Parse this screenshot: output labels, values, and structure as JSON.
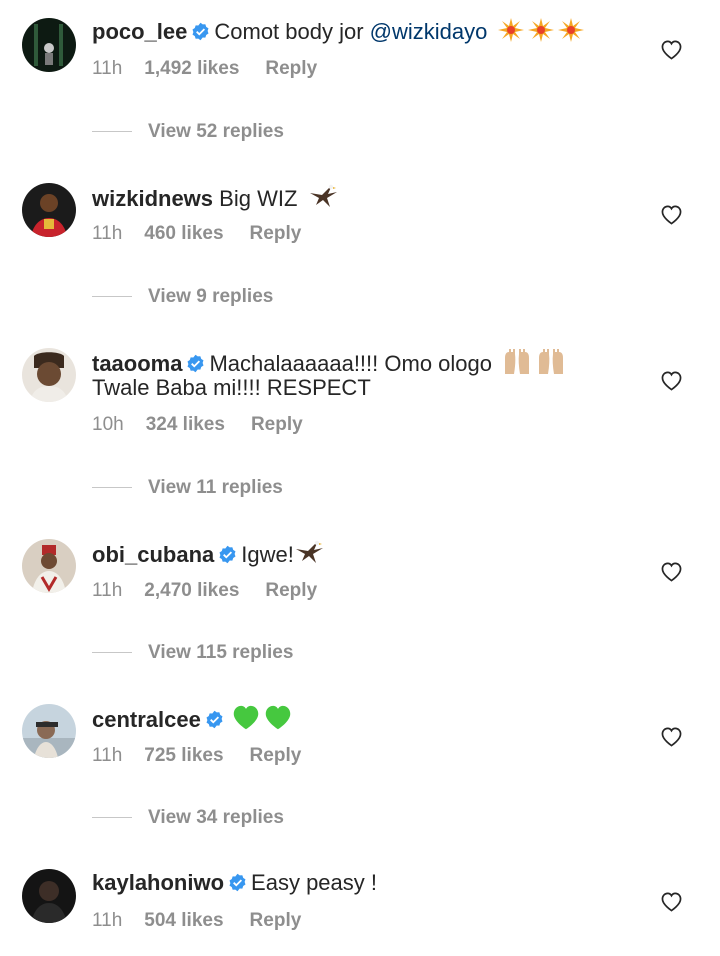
{
  "comments": [
    {
      "username": "poco_lee",
      "verified": true,
      "text": "Comot body jor ",
      "mention": "@wizkidayo",
      "time": "11h",
      "likes": "1,492 likes",
      "reply_label": "Reply",
      "view_replies": "View 52 replies"
    },
    {
      "username": "wizkidnews",
      "verified": false,
      "text": "Big WIZ",
      "time": "11h",
      "likes": "460 likes",
      "reply_label": "Reply",
      "view_replies": "View 9 replies"
    },
    {
      "username": "taaooma",
      "verified": true,
      "text": "Machalaaaaaa!!!! Omo ologo",
      "text_line2": "Twale Baba mi!!!! RESPECT",
      "time": "10h",
      "likes": "324 likes",
      "reply_label": "Reply",
      "view_replies": "View 11 replies"
    },
    {
      "username": "obi_cubana",
      "verified": true,
      "text": "Igwe!",
      "time": "11h",
      "likes": "2,470 likes",
      "reply_label": "Reply",
      "view_replies": "View 115 replies"
    },
    {
      "username": "centralcee",
      "verified": true,
      "text": "",
      "time": "11h",
      "likes": "725 likes",
      "reply_label": "Reply",
      "view_replies": "View 34 replies"
    },
    {
      "username": "kaylahoniwo",
      "verified": true,
      "text": "Easy peasy !",
      "time": "11h",
      "likes": "504 likes",
      "reply_label": "Reply"
    }
  ],
  "colors": {
    "text": "#262626",
    "secondary": "#8e8e8e",
    "mention": "#00376b",
    "verified": "#3897f0"
  }
}
